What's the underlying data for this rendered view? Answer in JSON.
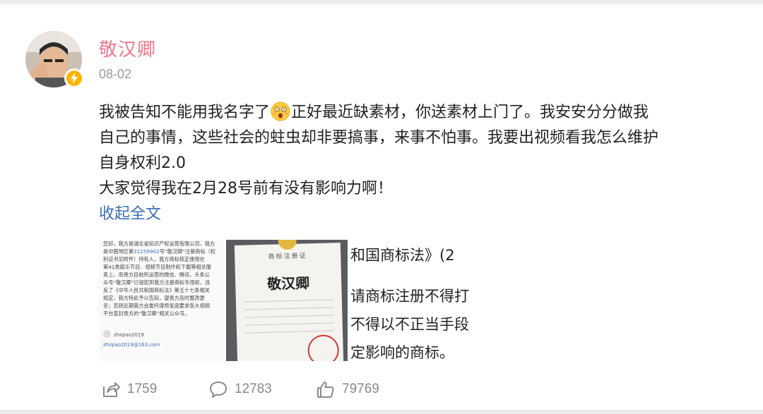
{
  "post": {
    "username": "敬汉卿",
    "date": "08-02",
    "content_lines": [
      "我被告知不能用我名字了",
      "正好最近缺素材，你送素材上门了。我安安分分做我",
      "自己的事情，这些社会的蛀虫却非要搞事，来事不怕事。我要出视频看我怎么维护",
      "自身权利2.0",
      "大家觉得我在2月28号前有没有影响力啊！"
    ],
    "collapse_label": "收起全文"
  },
  "images": {
    "doc_text": [
      "您好，我方是湖北省知识产权运营有限公司，我方",
      "是中国地区第",
      "31259902",
      "号“敬汉卿”注册商标（权",
      "利证书见附件）持有人，我方商标核定使用在",
      "第41类娱乐节目、视频节目制作和下载等相关服",
      "务上，而贵方目前所运营的微信、腾讯、头条公",
      "众号“敬汉卿”已侵犯到我方注册商标专用权，违",
      "反了《中华人民共和国商标法》第五十七条相关",
      "规定，我方特此予以告知，望贵方及时整改更",
      "名；否则近期我方会委托律师发函要求各大视频",
      "平台查封贵方的“敬汉卿”相关公众号。"
    ],
    "doc_signer": "zhiqiao2019",
    "doc_email": "zhiqiao2019@163.com",
    "cert_header": "商标注册证",
    "cert_name": "敬汉卿",
    "law_lines": [
      "和国商标法》(2",
      "请商标注册不得打",
      "不得以不正当手段",
      "定影响的商标。"
    ]
  },
  "actions": {
    "share_count": "1759",
    "comment_count": "12783",
    "like_count": "79769"
  },
  "colors": {
    "username": "#f2748b",
    "link": "#3a6dba",
    "badge": "#ffb400"
  }
}
